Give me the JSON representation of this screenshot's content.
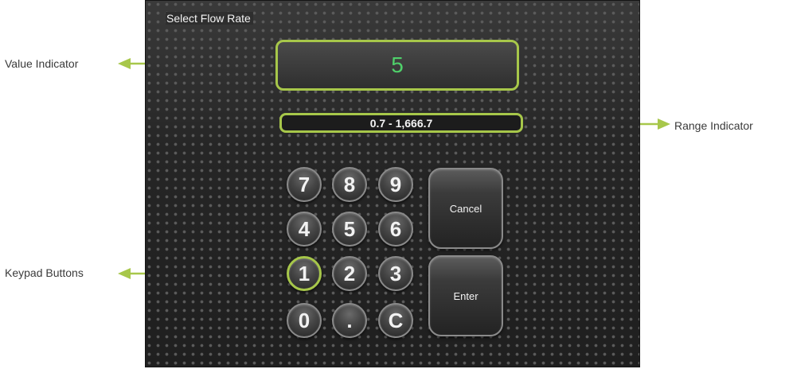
{
  "screen": {
    "title": "Select Flow Rate",
    "value": "5",
    "range": "0.7 - 1,666.7"
  },
  "keypad": {
    "keys": [
      "7",
      "8",
      "9",
      "4",
      "5",
      "6",
      "1",
      "2",
      "3",
      "0",
      ".",
      "C"
    ],
    "cancel_label": "Cancel",
    "enter_label": "Enter"
  },
  "annotations": {
    "value_indicator": "Value Indicator",
    "range_indicator": "Range Indicator",
    "keypad_buttons": "Keypad Buttons"
  },
  "colors": {
    "highlight": "#a7c74a",
    "value_text": "#4fd06a"
  }
}
